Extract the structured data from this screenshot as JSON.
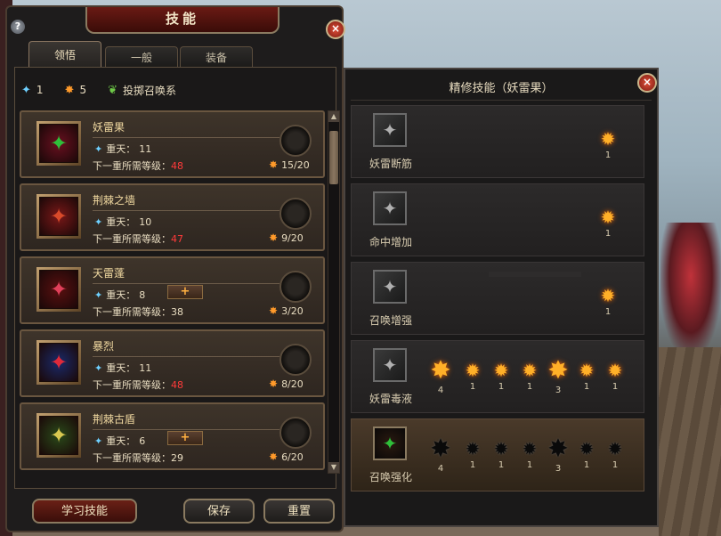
{
  "window": {
    "title": "技能",
    "help_icon": "?",
    "close_icon": "×"
  },
  "tabs": [
    {
      "label": "领悟",
      "active": true
    },
    {
      "label": "一般",
      "active": false
    },
    {
      "label": "装备",
      "active": false
    }
  ],
  "resources": {
    "blue_count": "1",
    "orange_count": "5",
    "school_label": "投掷召唤系"
  },
  "tier_prefix": "重天：",
  "next_prefix": "下一重所需等级：",
  "skills": [
    {
      "name": "妖雷果",
      "tier": "11",
      "next_level": "48",
      "next_level_red": true,
      "cost": "15/20",
      "has_plus": false,
      "icon": "green-gem-icon",
      "icon_color": "#2fbf3a",
      "icon_bg": "#6a1020"
    },
    {
      "name": "荆棘之墙",
      "tier": "10",
      "next_level": "47",
      "next_level_red": true,
      "cost": "9/20",
      "has_plus": false,
      "icon": "thorn-wall-icon",
      "icon_color": "#d84a2a",
      "icon_bg": "#7a1818"
    },
    {
      "name": "天雷蓬",
      "tier": "8",
      "next_level": "38",
      "next_level_red": false,
      "cost": "3/20",
      "has_plus": true,
      "icon": "thunder-pod-icon",
      "icon_color": "#e0405a",
      "icon_bg": "#5a1010"
    },
    {
      "name": "暴烈",
      "tier": "11",
      "next_level": "48",
      "next_level_red": true,
      "cost": "8/20",
      "has_plus": false,
      "icon": "violent-slash-icon",
      "icon_color": "#e02a3a",
      "icon_bg": "#1a2a6a"
    },
    {
      "name": "荆棘古盾",
      "tier": "6",
      "next_level": "29",
      "next_level_red": false,
      "cost": "6/20",
      "has_plus": true,
      "icon": "thorn-shield-icon",
      "icon_color": "#d8c850",
      "icon_bg": "#2a4a1a"
    }
  ],
  "buttons": {
    "learn": "学习技能",
    "save": "保存",
    "reset": "重置"
  },
  "refine": {
    "title": "精修技能（妖雷果）",
    "close_icon": "×",
    "rows": [
      {
        "name": "妖雷断筋",
        "stars": [
          {
            "count": "1",
            "lit": true,
            "big": false
          }
        ],
        "active": false
      },
      {
        "name": "命中增加",
        "stars": [
          {
            "count": "1",
            "lit": true,
            "big": false
          }
        ],
        "active": false
      },
      {
        "name": "召唤增强",
        "stars": [
          {
            "count": "1",
            "lit": true,
            "big": false
          }
        ],
        "active": false
      },
      {
        "name": "妖雷毒液",
        "stars": [
          {
            "count": "4",
            "lit": true,
            "big": true
          },
          {
            "count": "1",
            "lit": true,
            "big": false
          },
          {
            "count": "1",
            "lit": true,
            "big": false
          },
          {
            "count": "1",
            "lit": true,
            "big": false
          },
          {
            "count": "3",
            "lit": true,
            "big": true
          },
          {
            "count": "1",
            "lit": true,
            "big": false
          },
          {
            "count": "1",
            "lit": true,
            "big": false
          }
        ],
        "active": false
      },
      {
        "name": "召唤强化",
        "stars": [
          {
            "count": "4",
            "lit": false,
            "big": true
          },
          {
            "count": "1",
            "lit": false,
            "big": false
          },
          {
            "count": "1",
            "lit": false,
            "big": false
          },
          {
            "count": "1",
            "lit": false,
            "big": false
          },
          {
            "count": "3",
            "lit": false,
            "big": true
          },
          {
            "count": "1",
            "lit": false,
            "big": false
          },
          {
            "count": "1",
            "lit": false,
            "big": false
          }
        ],
        "active": true
      }
    ]
  }
}
